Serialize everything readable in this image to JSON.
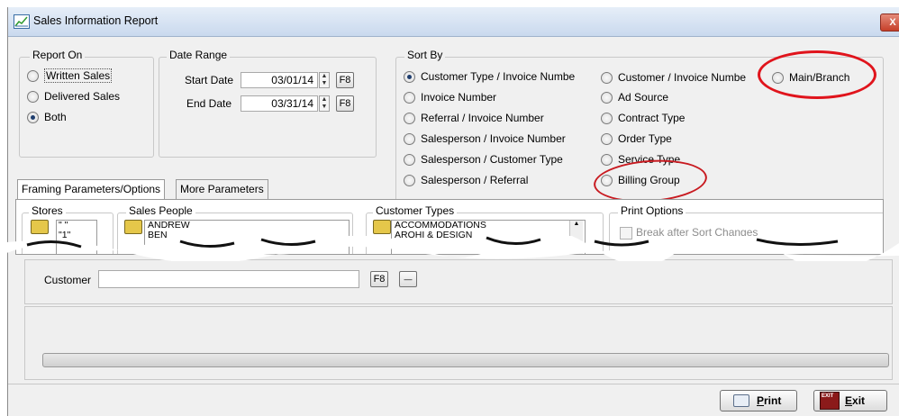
{
  "window": {
    "title": "Sales Information Report",
    "close_glyph": "X"
  },
  "report_on": {
    "legend": "Report On",
    "options": [
      {
        "label": "Written Sales",
        "selected": false
      },
      {
        "label": "Delivered Sales",
        "selected": false
      },
      {
        "label": "Both",
        "selected": true
      }
    ]
  },
  "date_range": {
    "legend": "Date Range",
    "start_label": "Start Date",
    "start_value": "03/01/14",
    "end_label": "End Date",
    "end_value": "03/31/14",
    "lookup_label": "F8"
  },
  "sort_by": {
    "legend": "Sort By",
    "col1": [
      {
        "label": "Customer Type / Invoice Numbe",
        "selected": true
      },
      {
        "label": "Invoice Number",
        "selected": false
      },
      {
        "label": "Referral / Invoice Number",
        "selected": false
      },
      {
        "label": "Salesperson / Invoice Number",
        "selected": false
      },
      {
        "label": "Salesperson / Customer Type",
        "selected": false
      },
      {
        "label": "Salesperson / Referral",
        "selected": false
      }
    ],
    "col2": [
      {
        "label": "Customer / Invoice Numbe",
        "selected": false
      },
      {
        "label": "Ad Source",
        "selected": false
      },
      {
        "label": "Contract Type",
        "selected": false
      },
      {
        "label": "Order Type",
        "selected": false
      },
      {
        "label": "Service Type",
        "selected": false
      },
      {
        "label": "Billing Group",
        "selected": false
      }
    ],
    "col3": [
      {
        "label": "Main/Branch",
        "selected": false
      }
    ]
  },
  "tabs": [
    {
      "label": "Framing Parameters/Options",
      "active": true
    },
    {
      "label": "More Parameters",
      "active": false
    }
  ],
  "framing": {
    "stores_legend": "Stores",
    "stores_items": [
      "\" \"",
      "\"1\""
    ],
    "sales_people_legend": "Sales People",
    "sales_people_items": [
      "ANDREW",
      "BEN"
    ],
    "customer_types_legend": "Customer Types",
    "customer_types_items": [
      "ACCOMMODATIONS",
      "AROHI & DESIGN"
    ],
    "print_options_legend": "Print Options",
    "break_label": "Break after Sort Changes"
  },
  "customer": {
    "label": "Customer",
    "value": "",
    "lookup_label": "F8",
    "clear_glyph": "—"
  },
  "buttons": {
    "print_label": "Print",
    "print_mnemonic": "P",
    "exit_label": "Exit",
    "exit_mnemonic": "E",
    "exit_icon_text": "EXIT"
  },
  "colors": {
    "annotation_red": "#e0141c",
    "selection_blue": "#1f3e6e"
  }
}
